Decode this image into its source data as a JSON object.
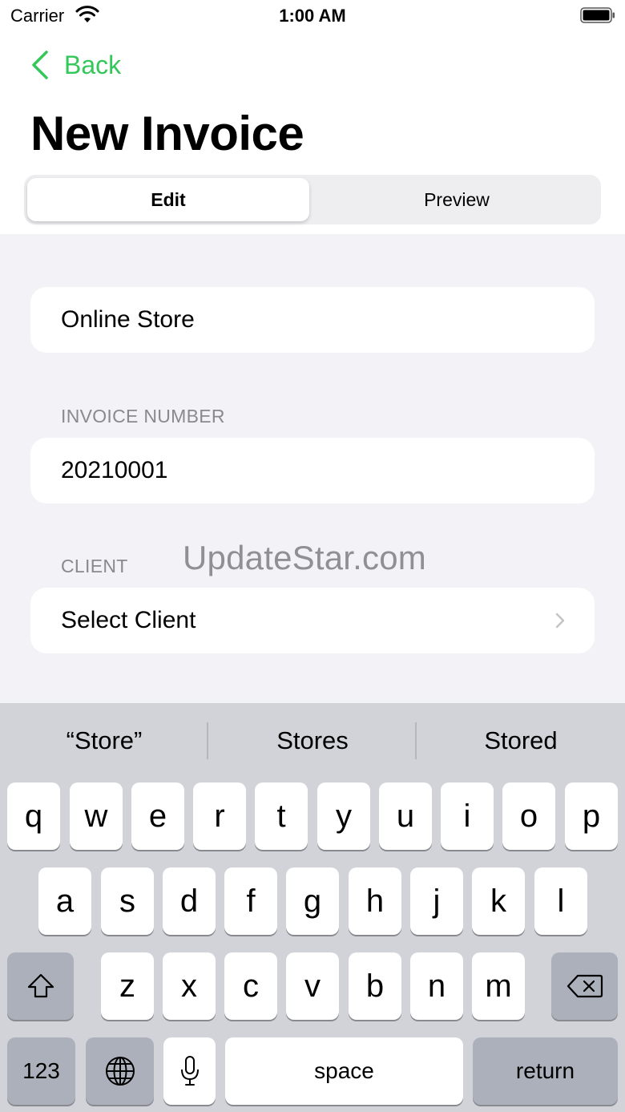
{
  "status_bar": {
    "carrier": "Carrier",
    "time": "1:00 AM"
  },
  "nav": {
    "back_label": "Back",
    "title": "New Invoice"
  },
  "segmented": {
    "edit": "Edit",
    "preview": "Preview",
    "selected": "Edit"
  },
  "form": {
    "store_name": "Online Store",
    "invoice_number_label": "INVOICE NUMBER",
    "invoice_number": "20210001",
    "client_label": "CLIENT",
    "client_value": "Select Client"
  },
  "watermark": "UpdateStar.com",
  "keyboard": {
    "suggestions": [
      "“Store”",
      "Stores",
      "Stored"
    ],
    "row1": [
      "q",
      "w",
      "e",
      "r",
      "t",
      "y",
      "u",
      "i",
      "o",
      "p"
    ],
    "row2": [
      "a",
      "s",
      "d",
      "f",
      "g",
      "h",
      "j",
      "k",
      "l"
    ],
    "row3": [
      "z",
      "x",
      "c",
      "v",
      "b",
      "n",
      "m"
    ],
    "numbers_key": "123",
    "space_key": "space",
    "return_key": "return",
    "icons": {
      "shift": "shift-icon",
      "backspace": "backspace-icon",
      "globe": "globe-icon",
      "mic": "microphone-icon"
    }
  },
  "colors": {
    "accent": "#34c759",
    "form_background": "#f2f2f7",
    "keyboard_background": "#d1d3d9"
  }
}
